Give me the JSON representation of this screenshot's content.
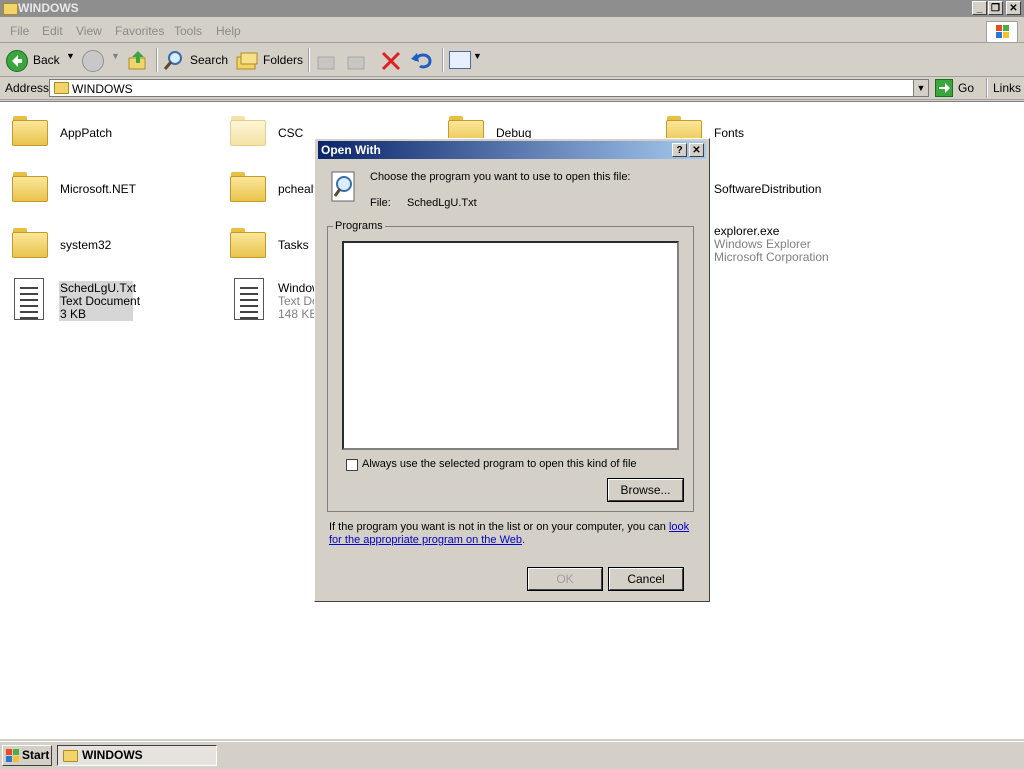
{
  "window": {
    "title": "WINDOWS",
    "caption_buttons": {
      "minimize": "_",
      "restore": "❐",
      "close": "✕"
    }
  },
  "menu": [
    "File",
    "Edit",
    "View",
    "Favorites",
    "Tools",
    "Help"
  ],
  "toolbar": {
    "back": "Back",
    "search": "Search",
    "folders": "Folders"
  },
  "address": {
    "label": "Address",
    "value": "WINDOWS",
    "go": "Go",
    "links": "Links"
  },
  "items": [
    {
      "name": "AppPatch"
    },
    {
      "name": "CSC"
    },
    {
      "name": "Debug"
    },
    {
      "name": "Fonts"
    },
    {
      "name": "Microsoft.NET"
    },
    {
      "name": "pchealt"
    },
    {
      "name": "SoftwareDistribution"
    },
    {
      "name": "system32"
    },
    {
      "name": "Tasks"
    },
    {
      "name": "explorer.exe",
      "line2": "Windows Explorer",
      "line3": "Microsoft Corporation"
    },
    {
      "name": "SchedLgU.Txt",
      "line2": "Text Document",
      "line3": "3 KB"
    },
    {
      "name": "Window",
      "line2": "Text Do",
      "line3": "148 KB"
    }
  ],
  "dialog": {
    "title": "Open With",
    "help": "?",
    "close": "✕",
    "prompt": "Choose the program you want to use to open this file:",
    "file_label": "File:",
    "file_name": "SchedLgU.Txt",
    "programs_label": "Programs",
    "always_use": "Always use the selected program to open this kind of file",
    "browse": "Browse...",
    "info_text": "If the program you want is not in the list or on your computer, you can",
    "info_link_1": "look",
    "info_link_2": "for the appropriate program on the Web",
    "info_end": ".",
    "ok": "OK",
    "cancel": "Cancel"
  },
  "taskbar": {
    "start": "Start",
    "task": "WINDOWS"
  },
  "colors": {
    "dialog_title_start": "#0a246a",
    "dialog_title_end": "#a6caf0",
    "link": "#0000cc"
  }
}
